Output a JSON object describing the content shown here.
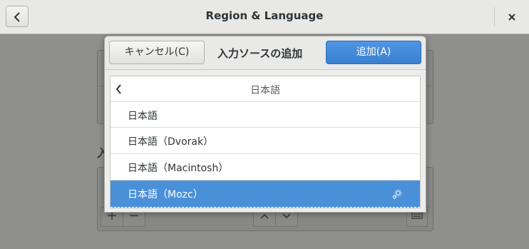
{
  "window": {
    "title": "Region & Language",
    "back_icon": "chevron-left-icon",
    "close_icon": "close-icon"
  },
  "background": {
    "section_heading": "入"
  },
  "dialog": {
    "cancel_label": "キャンセル(C)",
    "title": "入力ソースの追加",
    "add_label": "追加(A)",
    "accent_color": "#4a90d9",
    "list": {
      "header": "日本語",
      "items": [
        {
          "label": "日本語"
        },
        {
          "label": "日本語（Dvorak）"
        },
        {
          "label": "日本語（Macintosh）"
        },
        {
          "label": "日本語（Mozc）",
          "selected": true,
          "settings_icon": "gear-icon"
        }
      ]
    }
  },
  "bottom_toolbar": {
    "add_symbol": "+",
    "remove_symbol": "−"
  }
}
